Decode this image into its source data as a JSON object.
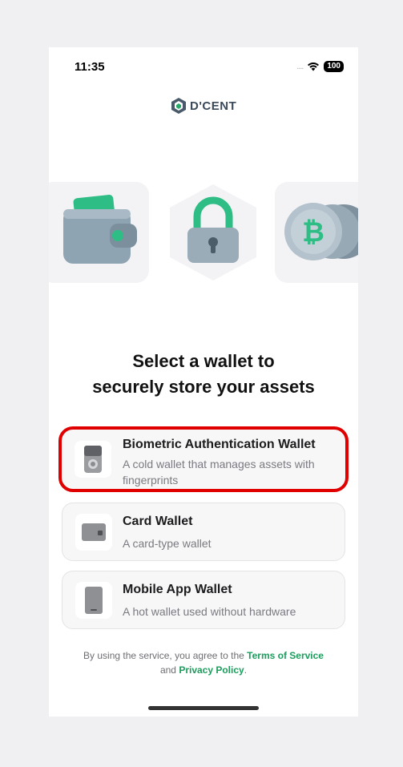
{
  "status_bar": {
    "time": "11:35",
    "signal": "....",
    "battery": "100"
  },
  "logo": {
    "text": "D'CENT"
  },
  "heading": {
    "line1": "Select a wallet to",
    "line2": "securely store your assets"
  },
  "options": [
    {
      "title": "Biometric Authentication Wallet",
      "description": "A cold wallet that manages assets with fingerprints",
      "icon": "biometric-device-icon",
      "highlighted": true
    },
    {
      "title": "Card Wallet",
      "description": "A card-type wallet",
      "icon": "card-icon",
      "highlighted": false
    },
    {
      "title": "Mobile App Wallet",
      "description": "A hot wallet used without hardware",
      "icon": "phone-icon",
      "highlighted": false
    }
  ],
  "terms": {
    "prefix": "By using the service, you agree to the",
    "terms_link": "Terms of Service",
    "and": "and",
    "privacy_link": "Privacy Policy",
    "suffix": "."
  },
  "colors": {
    "accent": "#1a9e5c",
    "highlight": "#e00000",
    "background": "#ffffff"
  }
}
